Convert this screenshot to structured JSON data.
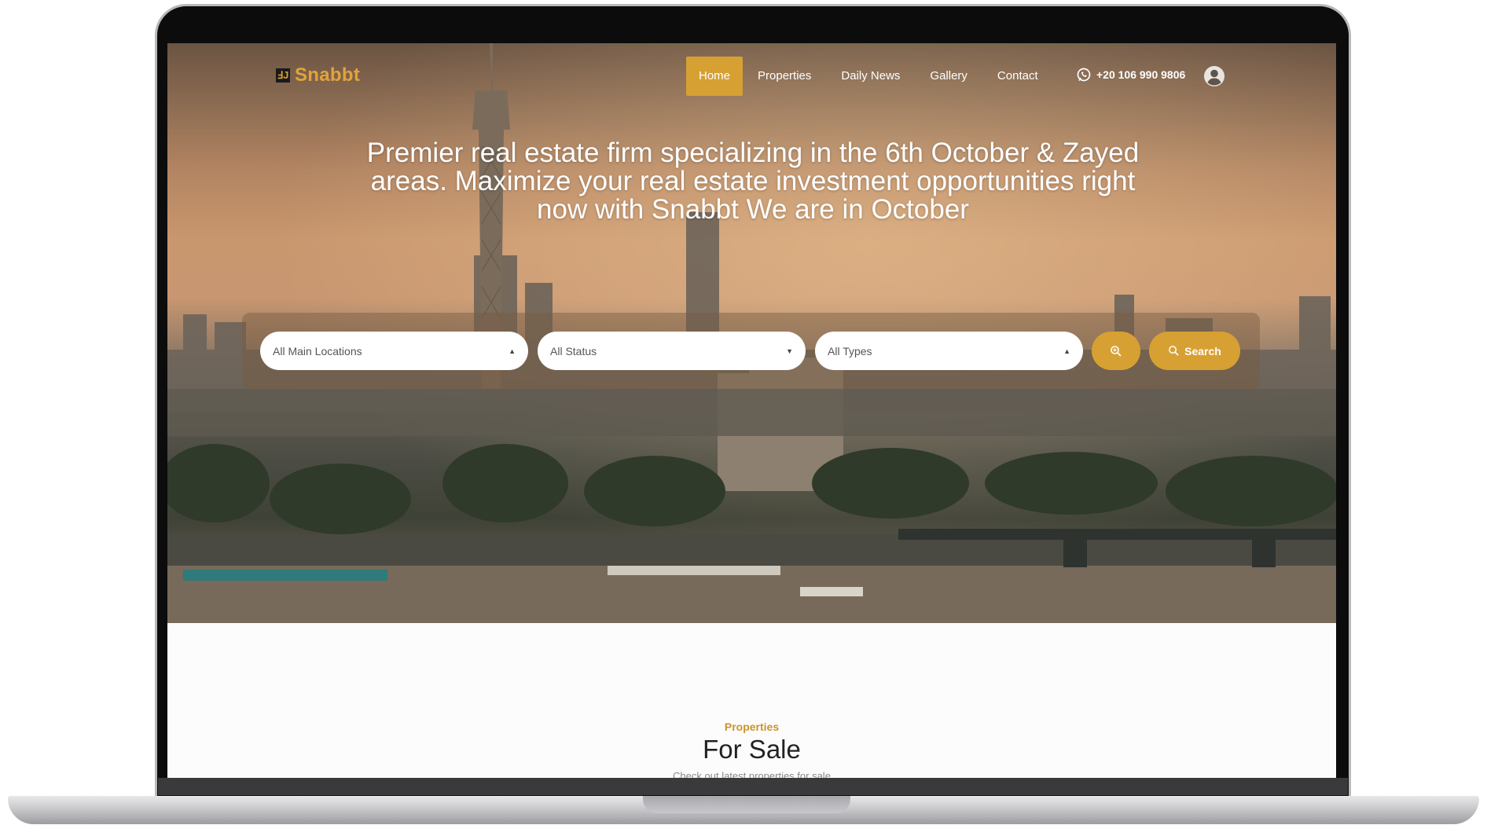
{
  "brand": {
    "logo_mark": "ℲJ",
    "name": "Snabbt",
    "accent_color": "#d7a033"
  },
  "nav": {
    "items": [
      {
        "label": "Home",
        "active": true
      },
      {
        "label": "Properties",
        "active": false
      },
      {
        "label": "Daily News",
        "active": false
      },
      {
        "label": "Gallery",
        "active": false
      },
      {
        "label": "Contact",
        "active": false
      }
    ],
    "phone": "+20 106 990 9806",
    "phone_icon": "whatsapp-icon",
    "account_icon": "user-circle-icon"
  },
  "hero": {
    "headline": "Premier real estate firm specializing in the 6th October & Zayed areas. Maximize your real estate investment opportunities right now with Snabbt We are in October"
  },
  "search": {
    "location_select": "All Main Locations",
    "status_select": "All Status",
    "type_select": "All Types",
    "advanced_icon": "zoom-search-icon",
    "search_label": "Search",
    "search_icon": "search-icon"
  },
  "section": {
    "kicker": "Properties",
    "title": "For Sale",
    "subtitle": "Check out latest properties for sale"
  }
}
